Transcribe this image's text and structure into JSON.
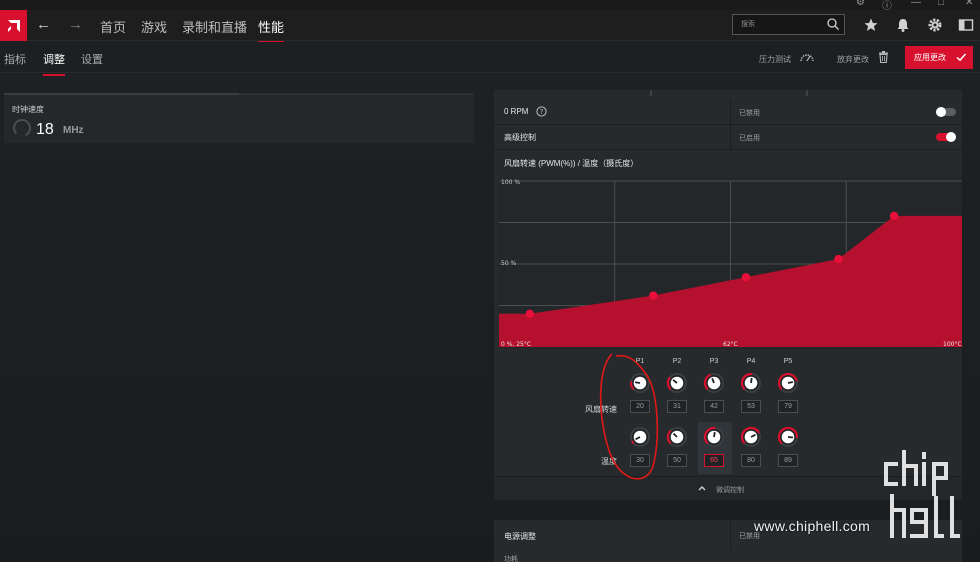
{
  "colors": {
    "accent": "#d7102e",
    "panel": "#262a2c",
    "background": "#1c2022"
  },
  "topnav": {
    "items": [
      {
        "label": "首页",
        "active": false
      },
      {
        "label": "游戏",
        "active": false
      },
      {
        "label": "录制和直播",
        "active": false
      },
      {
        "label": "性能",
        "active": true
      }
    ],
    "search_placeholder": "搜索"
  },
  "subnav": {
    "tabs": [
      {
        "label": "指标",
        "active": false
      },
      {
        "label": "调整",
        "active": true
      },
      {
        "label": "设置",
        "active": false
      }
    ],
    "stress_test": "压力测试",
    "discard_changes": "放弃更改",
    "apply_changes": "应用更改"
  },
  "clock_card": {
    "label": "时钟速度",
    "value": "18",
    "unit": "MHz"
  },
  "fan": {
    "zero_rpm": {
      "label": "0 RPM",
      "state": "已禁用",
      "enabled": false
    },
    "advanced": {
      "label": "高级控制",
      "state": "已启用",
      "enabled": true
    },
    "chart_title": "风扇转速 (PWM(%)) / 温度（摄氏度）",
    "collapse_label": "微调控制",
    "row_labels": {
      "speed": "风扇转速",
      "temp": "温度"
    },
    "points": [
      {
        "name": "P1",
        "speed": "20",
        "temp": "30"
      },
      {
        "name": "P2",
        "speed": "31",
        "temp": "50"
      },
      {
        "name": "P3",
        "speed": "42",
        "temp": "65"
      },
      {
        "name": "P4",
        "speed": "53",
        "temp": "80"
      },
      {
        "name": "P5",
        "speed": "79",
        "temp": "89"
      }
    ]
  },
  "chart_data": {
    "type": "area",
    "title": "风扇转速 (PWM(%)) / 温度（摄氏度）",
    "x_tick_labels": [
      "0 %, 25°C",
      "62°C",
      "100°C"
    ],
    "y_tick_labels": [
      "100 %",
      "50 %"
    ],
    "xlim": [
      25,
      100
    ],
    "ylim": [
      0,
      100
    ],
    "series": [
      {
        "x": [
          30,
          50,
          65,
          80,
          89
        ],
        "values": [
          20,
          31,
          42,
          53,
          79
        ]
      }
    ],
    "grid": true
  },
  "power": {
    "label": "电源调整",
    "state": "已禁用",
    "sub": "功耗"
  },
  "watermark": {
    "url": "www.chiphell.com"
  }
}
